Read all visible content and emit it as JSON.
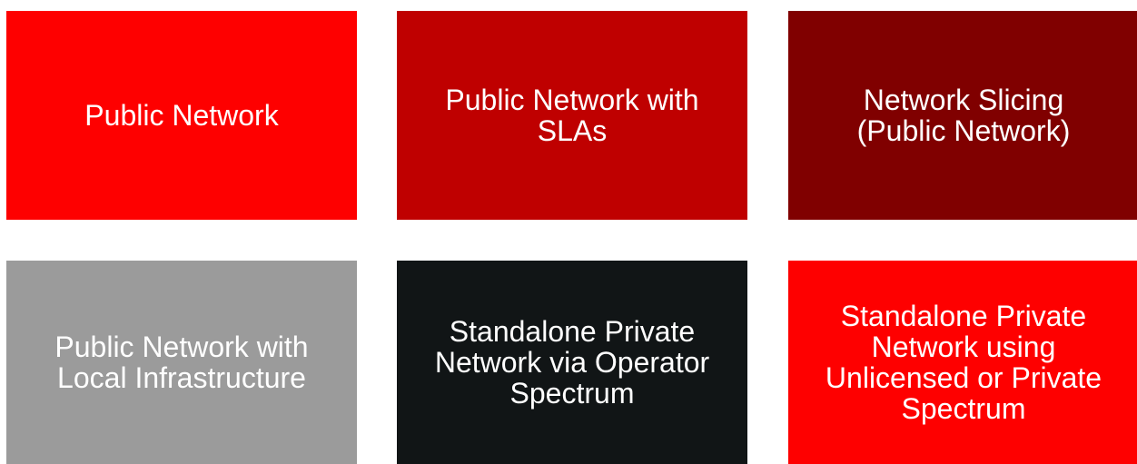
{
  "tiles": [
    {
      "label": "Public Network",
      "color": "#fe0000"
    },
    {
      "label": "Public Network with SLAs",
      "color": "#bf0000"
    },
    {
      "label": "Network Slicing (Public Network)",
      "color": "#800000"
    },
    {
      "label": "Public Network with Local Infrastructure",
      "color": "#9b9b9b"
    },
    {
      "label": "Standalone Private Network via Operator Spectrum",
      "color": "#111516"
    },
    {
      "label": "Standalone Private Network using Unlicensed or Private Spectrum",
      "color": "#fe0000"
    }
  ]
}
